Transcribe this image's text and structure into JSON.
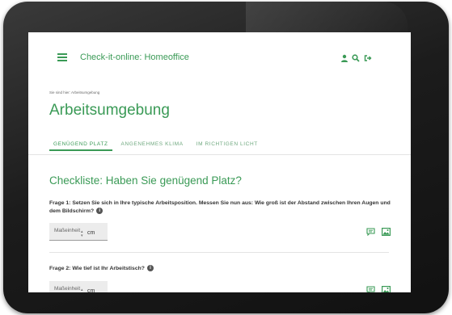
{
  "app": {
    "title": "Check-it-online: Homeoffice",
    "accent_color": "#3a9a56",
    "icons": [
      "menu-icon",
      "user-icon",
      "search-icon",
      "logout-icon"
    ]
  },
  "breadcrumb": {
    "prefix": "Sie sind hier:",
    "current": "Arbeitsumgebung"
  },
  "page": {
    "title": "Arbeitsumgebung"
  },
  "tabs": [
    {
      "label": "GENÜGEND PLATZ",
      "active": true
    },
    {
      "label": "ANGENEHMES KLIMA",
      "active": false
    },
    {
      "label": "IM RICHTIGEN LICHT",
      "active": false
    }
  ],
  "checklist": {
    "title": "Checkliste: Haben Sie genügend Platz?",
    "questions": [
      {
        "text": "Frage 1: Setzen Sie sich in Ihre typische Arbeitsposition. Messen Sie nun aus: Wie groß ist der Abstand zwischen Ihren Augen und dem Bildschirm?",
        "input_placeholder": "Maßeinheit",
        "unit": "cm"
      },
      {
        "text": "Frage 2: Wie tief ist Ihr Arbeitstisch?",
        "input_placeholder": "Maßeinheit",
        "unit": "cm"
      }
    ]
  }
}
